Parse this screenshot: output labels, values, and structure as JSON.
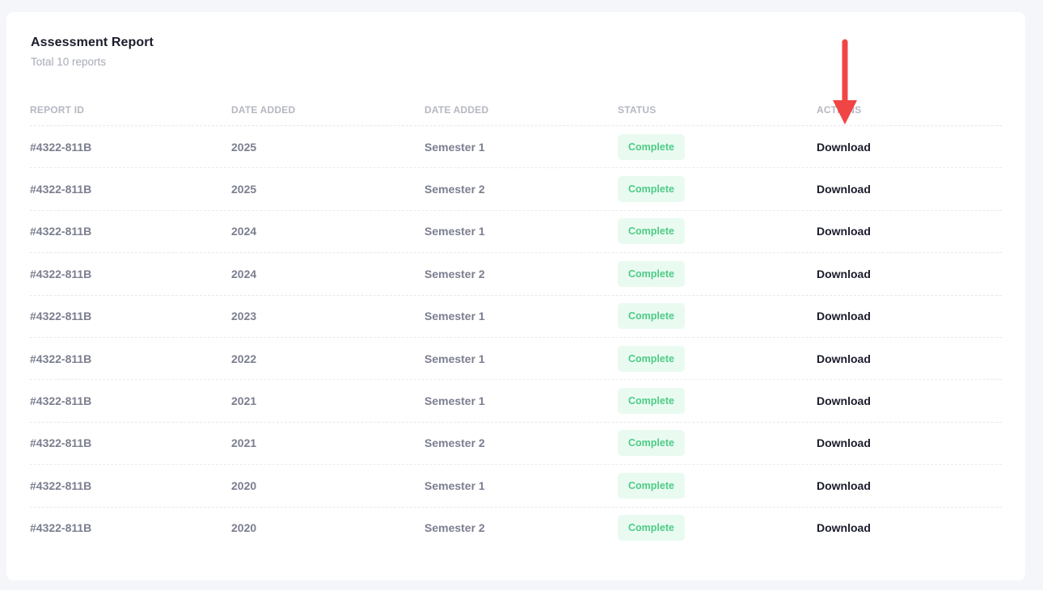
{
  "card": {
    "title": "Assessment Report",
    "subtitle": "Total 10 reports"
  },
  "table": {
    "headers": [
      "REPORT ID",
      "DATE ADDED",
      "DATE ADDED",
      "STATUS",
      "ACTIONS"
    ],
    "rows": [
      {
        "id": "#4322-811B",
        "year": "2025",
        "term": "Semester 1",
        "status": "Complete",
        "action": "Download"
      },
      {
        "id": "#4322-811B",
        "year": "2025",
        "term": "Semester 2",
        "status": "Complete",
        "action": "Download"
      },
      {
        "id": "#4322-811B",
        "year": "2024",
        "term": "Semester 1",
        "status": "Complete",
        "action": "Download"
      },
      {
        "id": "#4322-811B",
        "year": "2024",
        "term": "Semester 2",
        "status": "Complete",
        "action": "Download"
      },
      {
        "id": "#4322-811B",
        "year": "2023",
        "term": "Semester 1",
        "status": "Complete",
        "action": "Download"
      },
      {
        "id": "#4322-811B",
        "year": "2022",
        "term": "Semester 1",
        "status": "Complete",
        "action": "Download"
      },
      {
        "id": "#4322-811B",
        "year": "2021",
        "term": "Semester 1",
        "status": "Complete",
        "action": "Download"
      },
      {
        "id": "#4322-811B",
        "year": "2021",
        "term": "Semester 2",
        "status": "Complete",
        "action": "Download"
      },
      {
        "id": "#4322-811B",
        "year": "2020",
        "term": "Semester 1",
        "status": "Complete",
        "action": "Download"
      },
      {
        "id": "#4322-811B",
        "year": "2020",
        "term": "Semester 2",
        "status": "Complete",
        "action": "Download"
      }
    ]
  },
  "annotation": {
    "icon": "arrow-down-icon",
    "color": "#f04545"
  },
  "colors": {
    "status_badge_bg": "#e9fbf1",
    "status_badge_text": "#4fcb86"
  }
}
